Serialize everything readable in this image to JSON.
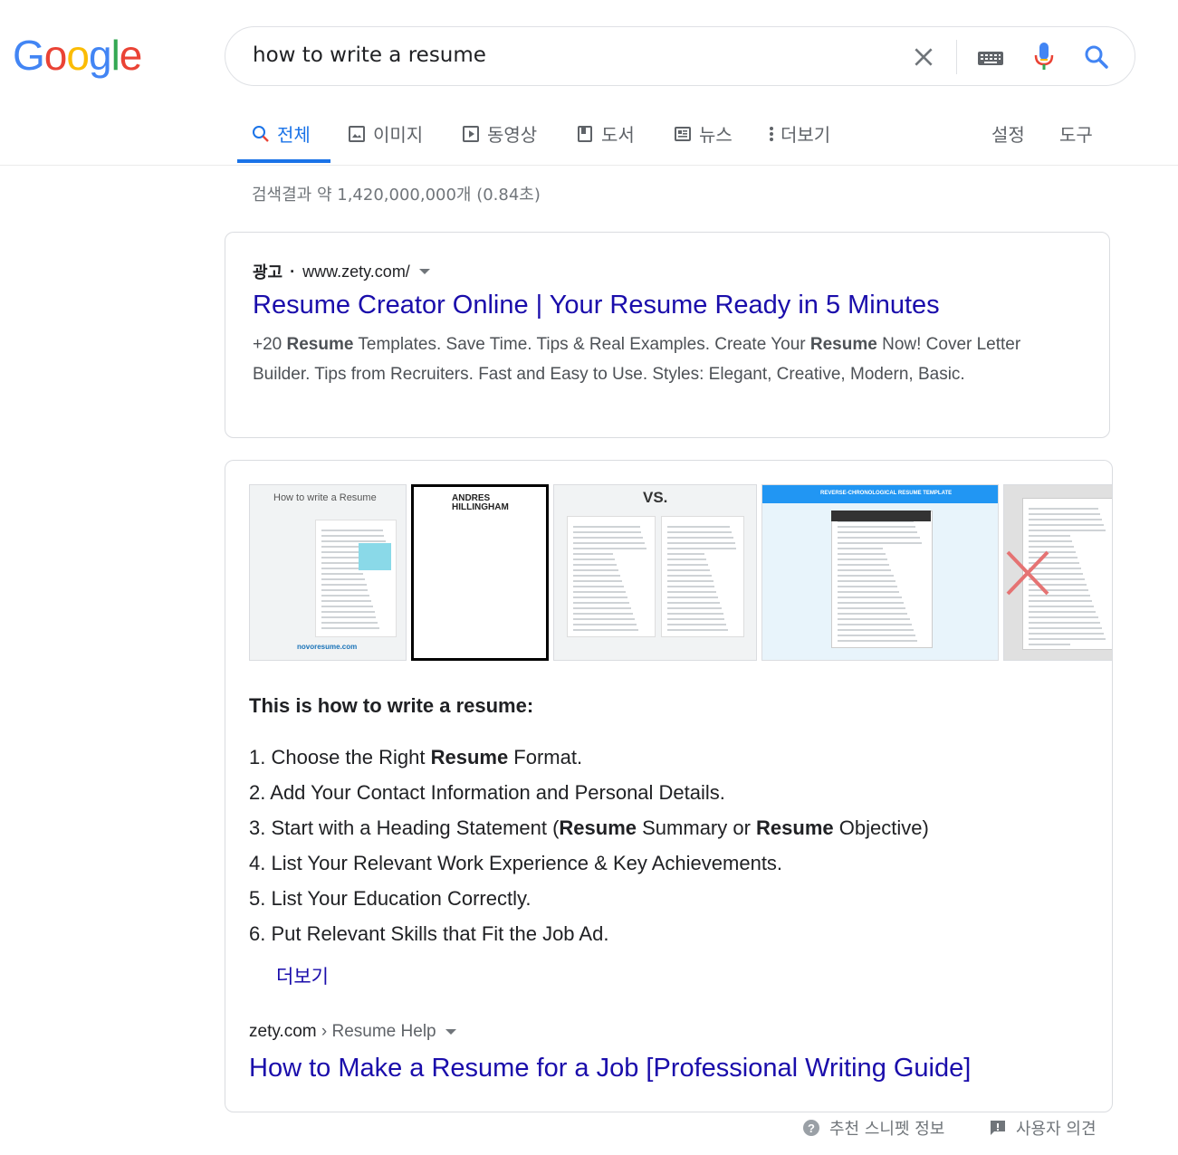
{
  "logo": {
    "letters": [
      "G",
      "o",
      "o",
      "g",
      "l",
      "e"
    ],
    "colors": [
      "#4285f4",
      "#ea4335",
      "#fbbc05",
      "#4285f4",
      "#34a853",
      "#ea4335"
    ]
  },
  "search": {
    "query": "how to write a resume"
  },
  "tabs": [
    {
      "label": "전체",
      "icon": "search-icon"
    },
    {
      "label": "이미지",
      "icon": "image-icon"
    },
    {
      "label": "동영상",
      "icon": "video-icon"
    },
    {
      "label": "도서",
      "icon": "book-icon"
    },
    {
      "label": "뉴스",
      "icon": "news-icon"
    },
    {
      "label": "더보기",
      "icon": "more-vert-icon"
    }
  ],
  "tools": {
    "settings": "설정",
    "tools": "도구"
  },
  "stats": "검색결과 약 1,420,000,000개 (0.84초)",
  "ad": {
    "badge": "광고",
    "separator": "·",
    "url": "www.zety.com/",
    "title": "Resume Creator Online | Your Resume Ready in 5 Minutes",
    "desc_parts": [
      "+20 ",
      "Resume",
      " Templates. Save Time. Tips & Real Examples. Create Your ",
      "Resume",
      " Now! Cover Letter Builder. Tips from Recruiters. Fast and Easy to Use. Styles: Elegant, Creative, Modern, Basic."
    ]
  },
  "snippet": {
    "thumbs": [
      {
        "title": "How to write a Resume",
        "footer": "novoresume.com"
      },
      {
        "title": "ANDRES HILLINGHAM"
      },
      {
        "title": "VS."
      },
      {
        "title": "REVERSE-CHRONOLOGICAL RESUME TEMPLATE"
      },
      {
        "title": ""
      }
    ],
    "heading": "This is how to write a resume:",
    "items": [
      {
        "n": "1.",
        "parts": [
          [
            "Choose the Right ",
            false
          ],
          [
            "Resume",
            true
          ],
          [
            " Format.",
            false
          ]
        ]
      },
      {
        "n": "2.",
        "parts": [
          [
            "Add Your Contact Information and Personal Details.",
            false
          ]
        ]
      },
      {
        "n": "3.",
        "parts": [
          [
            "Start with a Heading Statement (",
            false
          ],
          [
            "Resume",
            true
          ],
          [
            " Summary or ",
            false
          ],
          [
            "Resume",
            true
          ],
          [
            " Objective)",
            false
          ]
        ]
      },
      {
        "n": "4.",
        "parts": [
          [
            "List Your Relevant Work Experience & Key Achievements.",
            false
          ]
        ]
      },
      {
        "n": "5.",
        "parts": [
          [
            "List Your Education Correctly.",
            false
          ]
        ]
      },
      {
        "n": "6.",
        "parts": [
          [
            "Put Relevant Skills that Fit the Job Ad.",
            false
          ]
        ]
      }
    ],
    "more": "더보기",
    "cite_domain": "zety.com",
    "cite_sep": " › ",
    "cite_path": "Resume Help",
    "result_title": "How to Make a Resume for a Job [Professional Writing Guide]"
  },
  "footer": {
    "about": "추천 스니펫 정보",
    "feedback": "사용자 의견"
  }
}
